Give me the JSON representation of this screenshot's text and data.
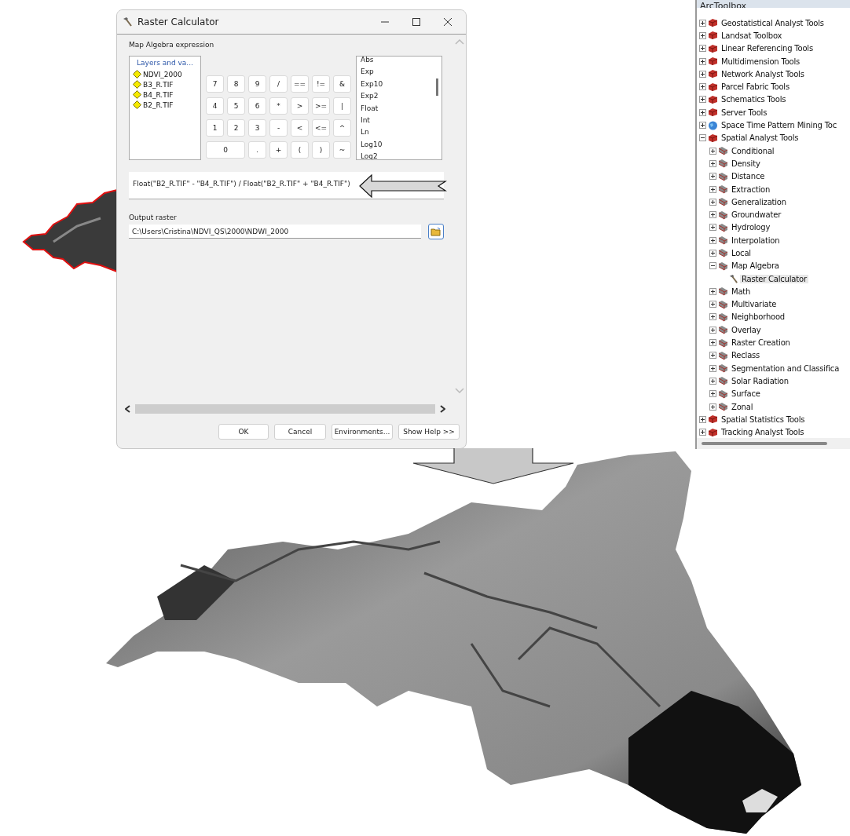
{
  "dialog": {
    "title": "Raster Calculator",
    "expression_label": "Map Algebra expression",
    "layers": {
      "title": "Layers and va...",
      "items": [
        "NDVI_2000",
        "B3_R.TIF",
        "B4_R.TIF",
        "B2_R.TIF"
      ]
    },
    "keypad": [
      [
        {
          "label": "7",
          "kind": "key"
        },
        {
          "label": "8",
          "kind": "key"
        },
        {
          "label": "9",
          "kind": "key"
        },
        {
          "label": "/",
          "kind": "key"
        },
        {
          "label": "==",
          "kind": "key"
        },
        {
          "label": "!=",
          "kind": "key"
        },
        {
          "label": "&",
          "kind": "key"
        }
      ],
      [
        {
          "label": "4",
          "kind": "key"
        },
        {
          "label": "5",
          "kind": "key"
        },
        {
          "label": "6",
          "kind": "key"
        },
        {
          "label": "*",
          "kind": "key"
        },
        {
          "label": ">",
          "kind": "key"
        },
        {
          "label": ">=",
          "kind": "key"
        },
        {
          "label": "|",
          "kind": "key"
        }
      ],
      [
        {
          "label": "1",
          "kind": "key"
        },
        {
          "label": "2",
          "kind": "key"
        },
        {
          "label": "3",
          "kind": "key"
        },
        {
          "label": "-",
          "kind": "key"
        },
        {
          "label": "<",
          "kind": "key"
        },
        {
          "label": "<=",
          "kind": "key"
        },
        {
          "label": "^",
          "kind": "key"
        }
      ],
      [
        {
          "label": "0",
          "kind": "wide"
        },
        {
          "label": ".",
          "kind": "key"
        },
        {
          "label": "+",
          "kind": "key"
        },
        {
          "label": "(",
          "kind": "key"
        },
        {
          "label": ")",
          "kind": "key"
        },
        {
          "label": "~",
          "kind": "key"
        }
      ]
    ],
    "functions": [
      "Abs",
      "Exp",
      "Exp10",
      "Exp2",
      "Float",
      "Int",
      "Ln",
      "Log10",
      "Log2"
    ],
    "expression": "Float(\"B2_R.TIF\" - \"B4_R.TIF\") / Float(\"B2_R.TIF\" + \"B4_R.TIF\")",
    "output_label": "Output raster",
    "output_value": "C:\\Users\\Cristina\\NDVI_QS\\2000\\NDWI_2000",
    "buttons": [
      "OK",
      "Cancel",
      "Environments...",
      "Show Help >>"
    ]
  },
  "toolbox": {
    "title": "ArcToolbox",
    "tree": [
      {
        "label": "Geostatistical Analyst Tools",
        "kind": "toolbox",
        "expanded": false
      },
      {
        "label": "Landsat Toolbox",
        "kind": "toolbox",
        "expanded": false
      },
      {
        "label": "Linear Referencing Tools",
        "kind": "toolbox",
        "expanded": false
      },
      {
        "label": "Multidimension Tools",
        "kind": "toolbox",
        "expanded": false
      },
      {
        "label": "Network Analyst Tools",
        "kind": "toolbox",
        "expanded": false
      },
      {
        "label": "Parcel Fabric Tools",
        "kind": "toolbox",
        "expanded": false
      },
      {
        "label": "Schematics Tools",
        "kind": "toolbox",
        "expanded": false
      },
      {
        "label": "Server Tools",
        "kind": "toolbox",
        "expanded": false
      },
      {
        "label": "Space Time Pattern Mining Toc",
        "kind": "globe",
        "expanded": false
      },
      {
        "label": "Spatial Analyst Tools",
        "kind": "toolbox",
        "expanded": true,
        "children": [
          {
            "label": "Conditional",
            "kind": "toolset",
            "expanded": false
          },
          {
            "label": "Density",
            "kind": "toolset",
            "expanded": false
          },
          {
            "label": "Distance",
            "kind": "toolset",
            "expanded": false
          },
          {
            "label": "Extraction",
            "kind": "toolset",
            "expanded": false
          },
          {
            "label": "Generalization",
            "kind": "toolset",
            "expanded": false
          },
          {
            "label": "Groundwater",
            "kind": "toolset",
            "expanded": false
          },
          {
            "label": "Hydrology",
            "kind": "toolset",
            "expanded": false
          },
          {
            "label": "Interpolation",
            "kind": "toolset",
            "expanded": false
          },
          {
            "label": "Local",
            "kind": "toolset",
            "expanded": false
          },
          {
            "label": "Map Algebra",
            "kind": "toolset",
            "expanded": true,
            "children": [
              {
                "label": "Raster Calculator",
                "kind": "tool",
                "selected": true
              }
            ]
          },
          {
            "label": "Math",
            "kind": "toolset",
            "expanded": false
          },
          {
            "label": "Multivariate",
            "kind": "toolset",
            "expanded": false
          },
          {
            "label": "Neighborhood",
            "kind": "toolset",
            "expanded": false
          },
          {
            "label": "Overlay",
            "kind": "toolset",
            "expanded": false
          },
          {
            "label": "Raster Creation",
            "kind": "toolset",
            "expanded": false
          },
          {
            "label": "Reclass",
            "kind": "toolset",
            "expanded": false
          },
          {
            "label": "Segmentation and Classifica",
            "kind": "toolset",
            "expanded": false
          },
          {
            "label": "Solar Radiation",
            "kind": "toolset",
            "expanded": false
          },
          {
            "label": "Surface",
            "kind": "toolset",
            "expanded": false
          },
          {
            "label": "Zonal",
            "kind": "toolset",
            "expanded": false
          }
        ]
      },
      {
        "label": "Spatial Statistics Tools",
        "kind": "toolbox",
        "expanded": false
      },
      {
        "label": "Tracking Analyst Tools",
        "kind": "toolbox",
        "expanded": false
      }
    ]
  }
}
